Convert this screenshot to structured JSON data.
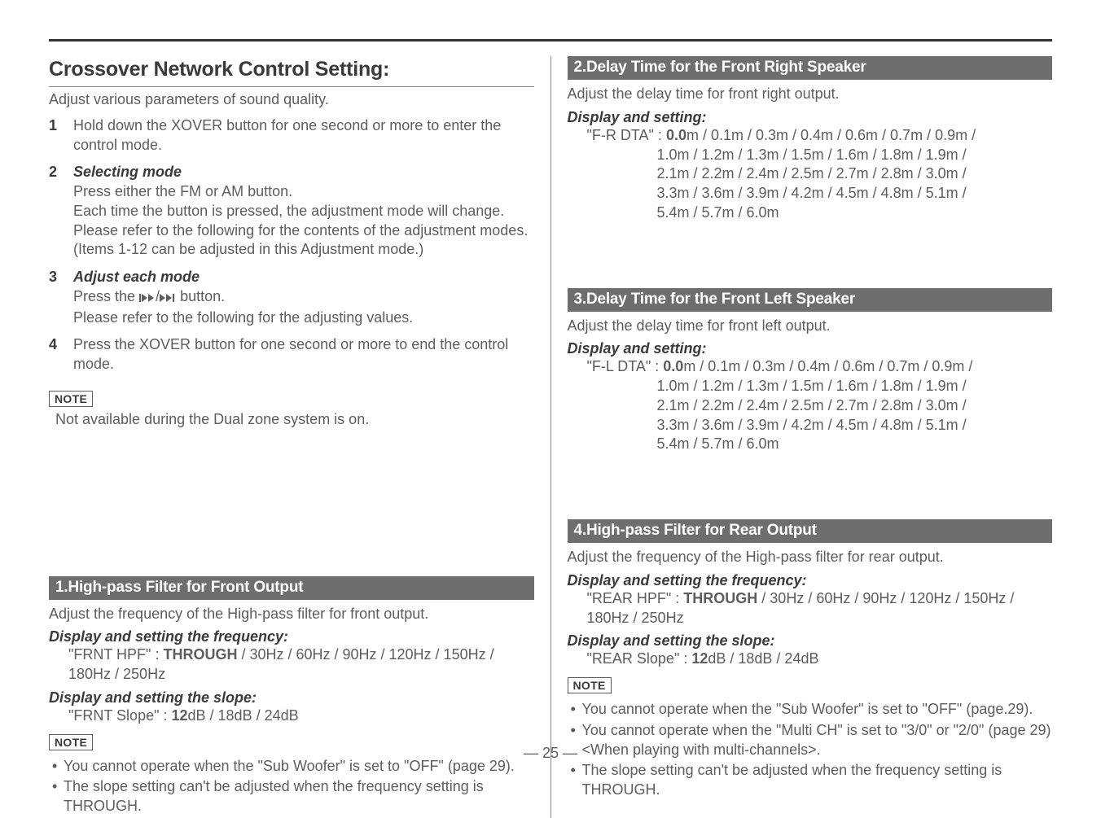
{
  "page_number": "— 25 —",
  "left": {
    "title": "Crossover Network Control Setting:",
    "intro": "Adjust various parameters of sound quality.",
    "steps": [
      {
        "num": "1",
        "body": "Hold down the XOVER button for one second or more to enter the control mode."
      },
      {
        "num": "2",
        "title": "Selecting mode",
        "lines": [
          "Press either the FM or AM button.",
          "Each time the button is pressed, the adjustment mode will change.",
          "Please refer to the following for the contents of the adjustment modes.(Items 1-12 can be adjusted in this Adjustment mode.)"
        ]
      },
      {
        "num": "3",
        "title": "Adjust each mode",
        "line_pre": "Press the ",
        "line_post": " button.",
        "line2": "Please refer to the following for the adjusting values."
      },
      {
        "num": "4",
        "body": "Press the XOVER button for one second or more to end the control mode."
      }
    ],
    "note_label": "NOTE",
    "note_text": "Not available during the Dual zone system is on.",
    "section1": {
      "bar": "1.High-pass Filter for Front Output",
      "intro": "Adjust the frequency of the High-pass filter for front output.",
      "freq_label": "Display and setting the frequency:",
      "freq_key": "\"FRNT HPF\" : ",
      "freq_bold": "THROUGH",
      "freq_rest": " / 30Hz / 60Hz / 90Hz / 120Hz / 150Hz / 180Hz / 250Hz",
      "slope_label": "Display and setting the slope:",
      "slope_key": "\"FRNT Slope\" : ",
      "slope_bold": "12",
      "slope_rest": "dB / 18dB / 24dB",
      "note_label": "NOTE",
      "bullets": [
        "You cannot operate when the \"Sub Woofer\" is set to \"OFF\" (page 29).",
        "The slope setting can't be adjusted when the frequency setting is THROUGH."
      ]
    }
  },
  "right": {
    "s2": {
      "bar": "2.Delay Time for the Front Right Speaker",
      "intro": "Adjust the delay time for front right output.",
      "ds_label": "Display and setting:",
      "key": "\"F-R DTA\" : ",
      "bold": "0.0",
      "rest_lines": [
        "m / 0.1m / 0.3m / 0.4m / 0.6m / 0.7m / 0.9m /",
        "1.0m / 1.2m / 1.3m / 1.5m / 1.6m / 1.8m / 1.9m /",
        "2.1m / 2.2m / 2.4m / 2.5m / 2.7m / 2.8m / 3.0m /",
        "3.3m / 3.6m / 3.9m / 4.2m / 4.5m / 4.8m / 5.1m /",
        "5.4m / 5.7m / 6.0m"
      ]
    },
    "s3": {
      "bar": "3.Delay Time for the Front Left Speaker",
      "intro": "Adjust the delay time for front left output.",
      "ds_label": "Display and setting:",
      "key": "\"F-L DTA\" : ",
      "bold": "0.0",
      "rest_lines": [
        "m / 0.1m / 0.3m / 0.4m / 0.6m / 0.7m / 0.9m /",
        "1.0m / 1.2m / 1.3m / 1.5m / 1.6m / 1.8m / 1.9m /",
        "2.1m / 2.2m / 2.4m / 2.5m / 2.7m / 2.8m / 3.0m /",
        "3.3m / 3.6m / 3.9m / 4.2m / 4.5m / 4.8m / 5.1m /",
        "5.4m / 5.7m / 6.0m"
      ]
    },
    "s4": {
      "bar": "4.High-pass Filter for Rear Output",
      "intro": "Adjust the frequency of the High-pass filter for rear output.",
      "freq_label": "Display and setting the frequency:",
      "freq_key": "\"REAR HPF\" : ",
      "freq_bold": "THROUGH",
      "freq_rest": " / 30Hz / 60Hz / 90Hz / 120Hz / 150Hz / 180Hz / 250Hz",
      "slope_label": "Display and setting the slope:",
      "slope_key": "\"REAR Slope\" : ",
      "slope_bold": "12",
      "slope_rest": "dB / 18dB / 24dB",
      "note_label": "NOTE",
      "bullets": [
        "You cannot operate when the \"Sub Woofer\" is set to \"OFF\" (page.29).",
        "You cannot operate when the \"Multi CH\" is set to \"3/0\" or \"2/0\" (page 29) <When playing with multi-channels>.",
        "The slope setting can't be adjusted when the frequency setting is THROUGH."
      ]
    }
  }
}
